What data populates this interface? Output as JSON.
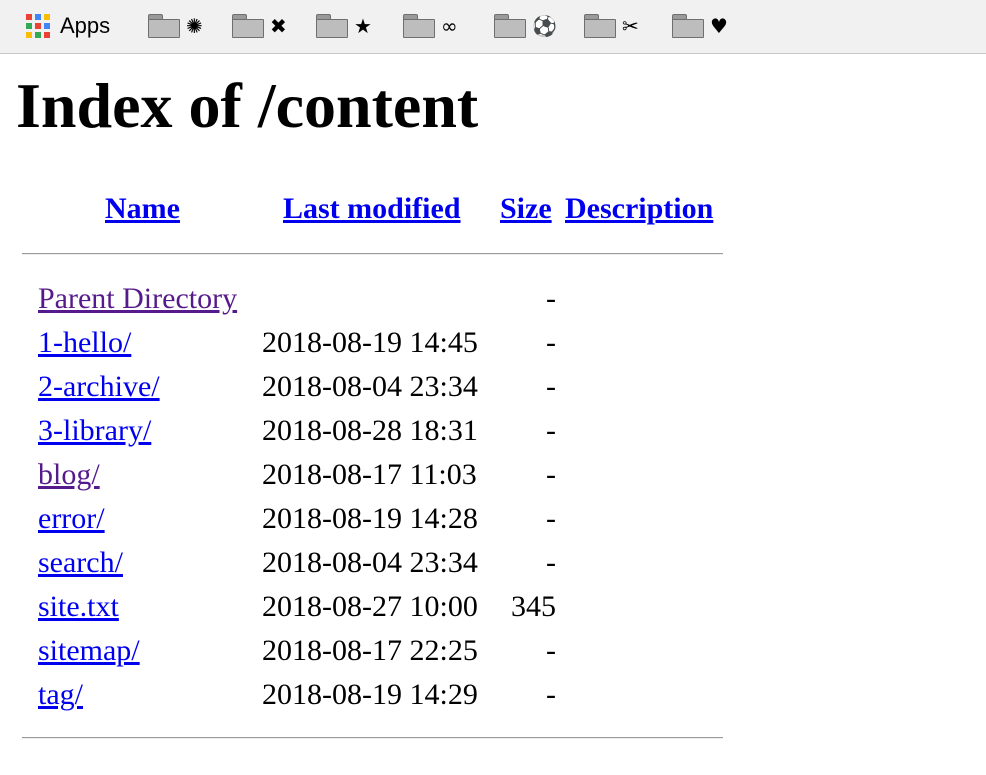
{
  "bookmarks_bar": {
    "apps_label": "Apps",
    "apps_colors": [
      "#ea4335",
      "#4285f4",
      "#fbbc05",
      "#34a853",
      "#ea4335",
      "#4285f4",
      "#fbbc05",
      "#34a853",
      "#ea4335"
    ],
    "folders": [
      {
        "glyph": "✺",
        "icon": "sunburst-icon"
      },
      {
        "glyph": "✖",
        "icon": "cross-icon"
      },
      {
        "glyph": "★",
        "icon": "star-icon"
      },
      {
        "glyph": "∞",
        "icon": "infinity-icon"
      },
      {
        "glyph": "⚽",
        "icon": "soccer-ball-icon"
      },
      {
        "glyph": "✂",
        "icon": "scissors-icon"
      },
      {
        "glyph": "♥",
        "icon": "heart-icon"
      }
    ]
  },
  "page": {
    "title": "Index of /content"
  },
  "table": {
    "headers": {
      "name": "Name",
      "last_modified": "Last modified",
      "size": "Size",
      "description": "Description"
    },
    "rows": [
      {
        "name": "Parent Directory",
        "modified": "",
        "size": "-",
        "visited": true
      },
      {
        "name": "1-hello/",
        "modified": "2018-08-19 14:45",
        "size": "-",
        "visited": false
      },
      {
        "name": "2-archive/",
        "modified": "2018-08-04 23:34",
        "size": "-",
        "visited": false
      },
      {
        "name": "3-library/",
        "modified": "2018-08-28 18:31",
        "size": "-",
        "visited": false
      },
      {
        "name": "blog/",
        "modified": "2018-08-17 11:03",
        "size": "-",
        "visited": true
      },
      {
        "name": "error/",
        "modified": "2018-08-19 14:28",
        "size": "-",
        "visited": false
      },
      {
        "name": "search/",
        "modified": "2018-08-04 23:34",
        "size": "-",
        "visited": false
      },
      {
        "name": "site.txt",
        "modified": "2018-08-27 10:00",
        "size": "345",
        "visited": false
      },
      {
        "name": "sitemap/",
        "modified": "2018-08-17 22:25",
        "size": "-",
        "visited": false
      },
      {
        "name": "tag/",
        "modified": "2018-08-19 14:29",
        "size": "-",
        "visited": false
      }
    ]
  },
  "colors": {
    "link": "#0000ee",
    "visited_link": "#551a8b"
  }
}
